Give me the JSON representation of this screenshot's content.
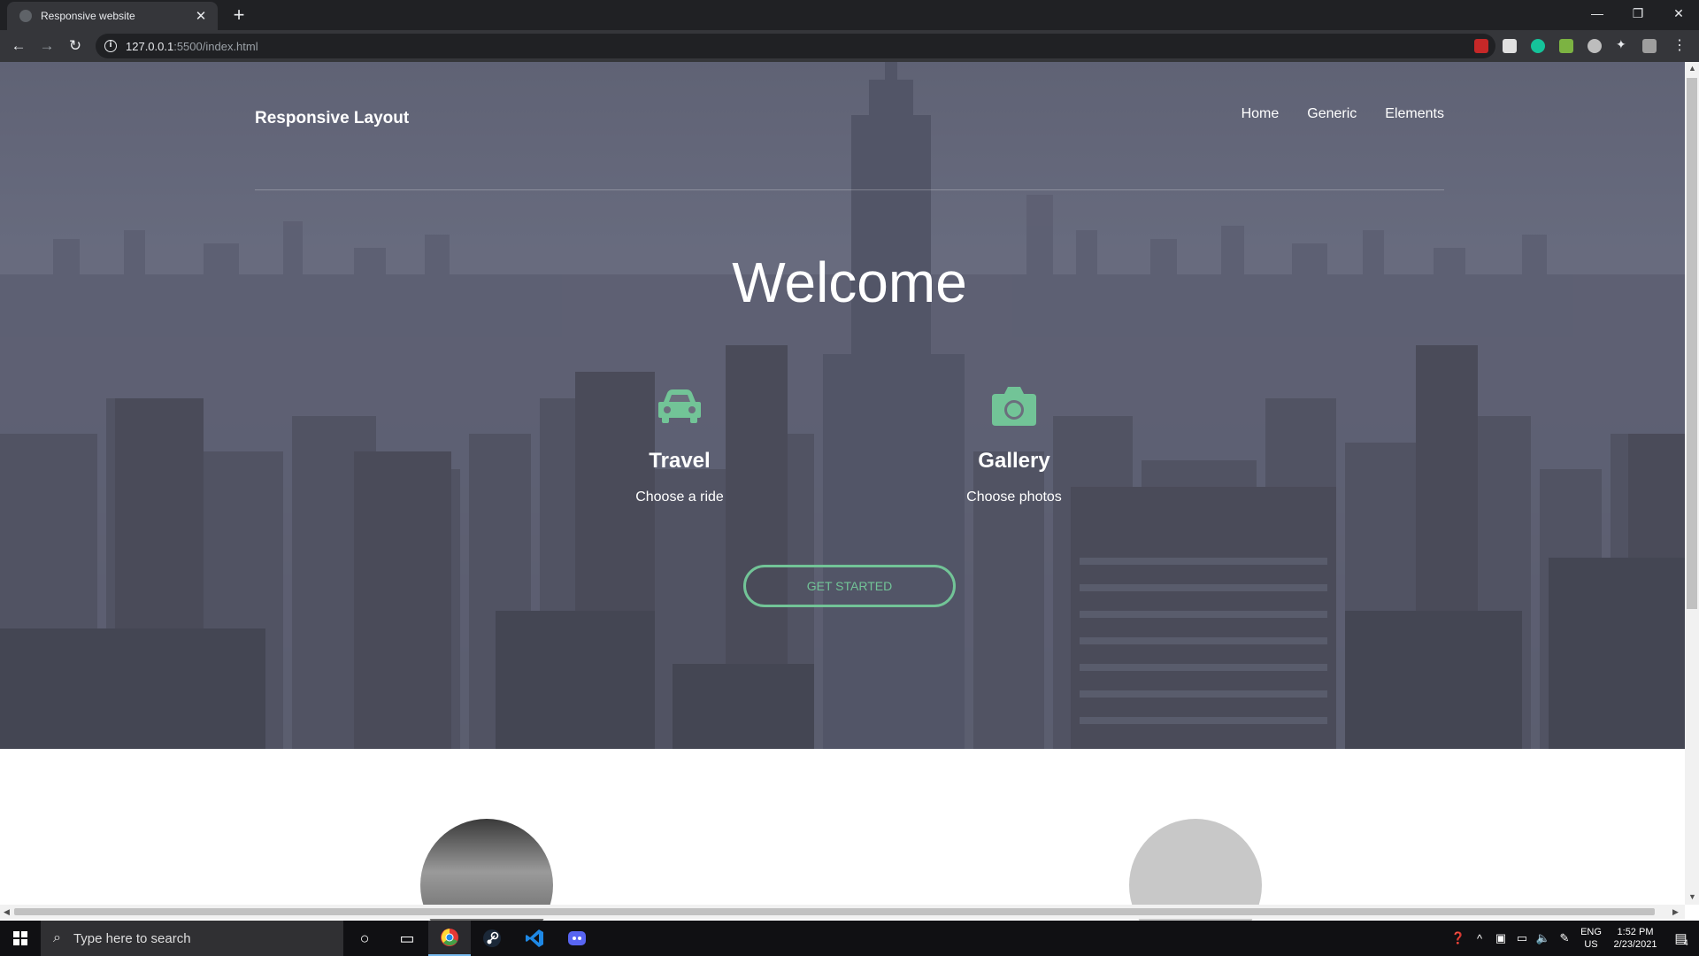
{
  "browser": {
    "tab_title": "Responsive website",
    "url_host": "127.0.0.1",
    "url_path": ":5500/index.html"
  },
  "page": {
    "brand": "Responsive Layout",
    "nav": [
      "Home",
      "Generic",
      "Elements"
    ],
    "heading": "Welcome",
    "features": [
      {
        "icon": "car-icon",
        "title": "Travel",
        "text": "Choose a ride"
      },
      {
        "icon": "camera-icon",
        "title": "Gallery",
        "text": "Choose photos"
      }
    ],
    "cta_label": "GET STARTED",
    "accent_color": "#72c497"
  },
  "taskbar": {
    "search_placeholder": "Type here to search",
    "lang_line1": "ENG",
    "lang_line2": "US",
    "time": "1:52 PM",
    "date": "2/23/2021",
    "notification_count": "4"
  }
}
